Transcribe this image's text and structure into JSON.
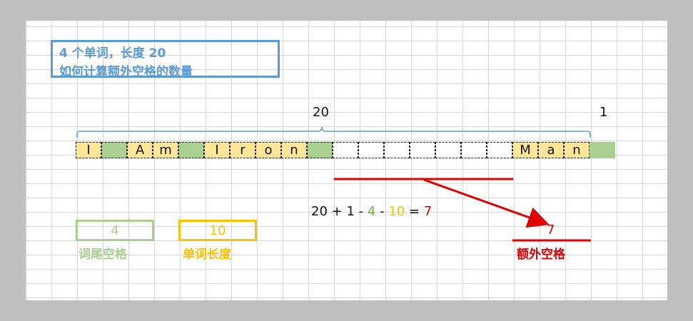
{
  "title": {
    "line1": "4 个单词，长度 20",
    "line2": "如何计算额外空格的数量"
  },
  "brace_label": "20",
  "extra_label": "1",
  "cells": [
    {
      "t": "I",
      "k": "letter"
    },
    {
      "t": "",
      "k": "space"
    },
    {
      "t": "A",
      "k": "letter"
    },
    {
      "t": "m",
      "k": "letter"
    },
    {
      "t": "",
      "k": "space"
    },
    {
      "t": "I",
      "k": "letter"
    },
    {
      "t": "r",
      "k": "letter"
    },
    {
      "t": "o",
      "k": "letter"
    },
    {
      "t": "n",
      "k": "letter"
    },
    {
      "t": "",
      "k": "space"
    },
    {
      "t": "",
      "k": "empty"
    },
    {
      "t": "",
      "k": "empty"
    },
    {
      "t": "",
      "k": "empty"
    },
    {
      "t": "",
      "k": "empty"
    },
    {
      "t": "",
      "k": "empty"
    },
    {
      "t": "",
      "k": "empty"
    },
    {
      "t": "",
      "k": "empty"
    },
    {
      "t": "M",
      "k": "letter"
    },
    {
      "t": "a",
      "k": "letter"
    },
    {
      "t": "n",
      "k": "letter"
    },
    {
      "t": "",
      "k": "extra"
    }
  ],
  "formula": {
    "a": "20",
    "op1": "+",
    "b": "1",
    "op2": "-",
    "c": "4",
    "op3": "-",
    "d": "10",
    "eq": "=",
    "result": "7"
  },
  "legend": {
    "trailing_value": "4",
    "trailing_caption": "词尾空格",
    "word_value": "10",
    "word_caption": "单词长度",
    "extra_value": "7",
    "extra_caption": "额外空格"
  },
  "colors": {
    "blue": "#5b9bd5",
    "green": "#a9d08e",
    "yellow": "#ffc000",
    "red": "#e00000",
    "letter_fill": "#ffe699"
  }
}
